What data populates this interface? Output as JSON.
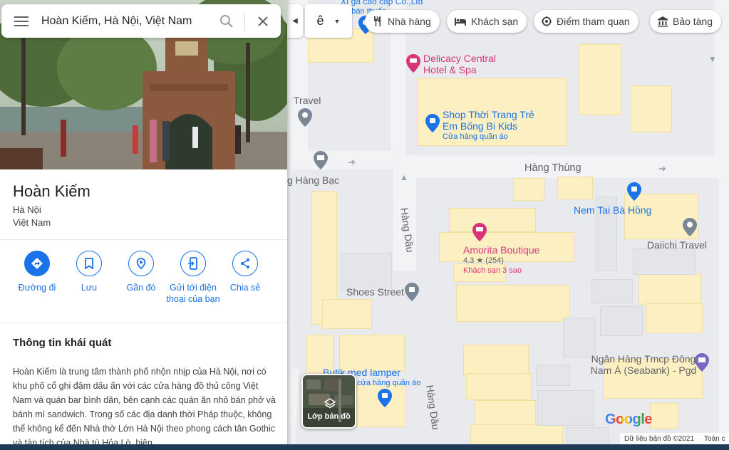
{
  "search": {
    "query": "Hoàn Kiếm, Hà Nội, Việt Nam",
    "menu_icon": "hamburger-icon",
    "search_icon": "search-icon",
    "close_icon": "close-icon"
  },
  "place": {
    "title": "Hoàn Kiếm",
    "line1": "Hà Nội",
    "line2": "Việt Nam"
  },
  "actions": [
    {
      "label": "Đường đi",
      "icon": "directions-icon"
    },
    {
      "label": "Lưu",
      "icon": "bookmark-icon"
    },
    {
      "label": "Gần đó",
      "icon": "nearby-icon"
    },
    {
      "label": "Gửi tới điện thoại của bạn",
      "icon": "send-to-phone-icon"
    },
    {
      "label": "Chia sẻ",
      "icon": "share-icon"
    }
  ],
  "about": {
    "title": "Thông tin khái quát",
    "text": "Hoàn Kiếm là trung tâm thành phố nhộn nhịp của Hà Nội, nơi có khu phố cổ ghi đậm dấu ấn với các cửa hàng đồ thủ công Việt Nam và quán bar bình dân, bên cạnh các quán ăn nhỏ bán phở và bánh mì sandwich. Trong số các địa danh thời Pháp thuộc, không thể không kể đến Nhà thờ Lớn Hà Nội theo phong cách tân Gothic và tàn tích của Nhà tù Hỏa Lò, hiện"
  },
  "toolbar": {
    "lang_label": "ê"
  },
  "chips": [
    {
      "label": "Nhà hàng",
      "icon": "restaurant-icon"
    },
    {
      "label": "Khách sạn",
      "icon": "hotel-icon"
    },
    {
      "label": "Điểm tham quan",
      "icon": "attraction-icon"
    },
    {
      "label": "Bảo tàng",
      "icon": "museum-icon"
    }
  ],
  "map": {
    "roads": {
      "hang_thung": "Hàng Thùng",
      "hang_dau_1": "Hàng Dầu",
      "hang_dau_2": "Hàng Dầu",
      "hang_bac": "g Hàng Bạc"
    },
    "pois": {
      "top_partial": "Xì gà cao cấp Co.,Ltd",
      "top_partial_sub": "ng bán thuốc",
      "delicacy": "Delicacy Central Hotel & Spa",
      "shop_thoi_trang": "Shop Thời Trang Trẻ Em Bống Bi Kids",
      "shop_thoi_trang_sub": "Cửa hàng quần áo",
      "travel_left": "Travel",
      "nem_tai": "Nem Tai Bà Hồng",
      "daiichi": "Daiichi Travel",
      "amorita": "Amorita Boutique",
      "amorita_rating": "4.3 ★ (254)",
      "amorita_sub": "Khách sạn 3 sao",
      "shoes_street": "Shoes Street",
      "butik": "Butik med lamper",
      "butik_sub": "cửa hàng quần áo",
      "ngan_hang": "Ngân Hàng Tmcp Đông Nam Á (Seabank) - Pgd"
    }
  },
  "layer_button": {
    "label": "Lớp bản đồ",
    "icon": "layers-icon"
  },
  "footer": {
    "data": "Dữ liệu bản đồ ©2021",
    "terms": "Toàn c"
  },
  "logo": "Google",
  "colors": {
    "accent": "#1a73e8",
    "hotel_pink": "#d93479",
    "shop_blue": "#1a73e8",
    "road_text": "#5f6368",
    "building": "#fcefc2",
    "block": "#e8eaed"
  }
}
